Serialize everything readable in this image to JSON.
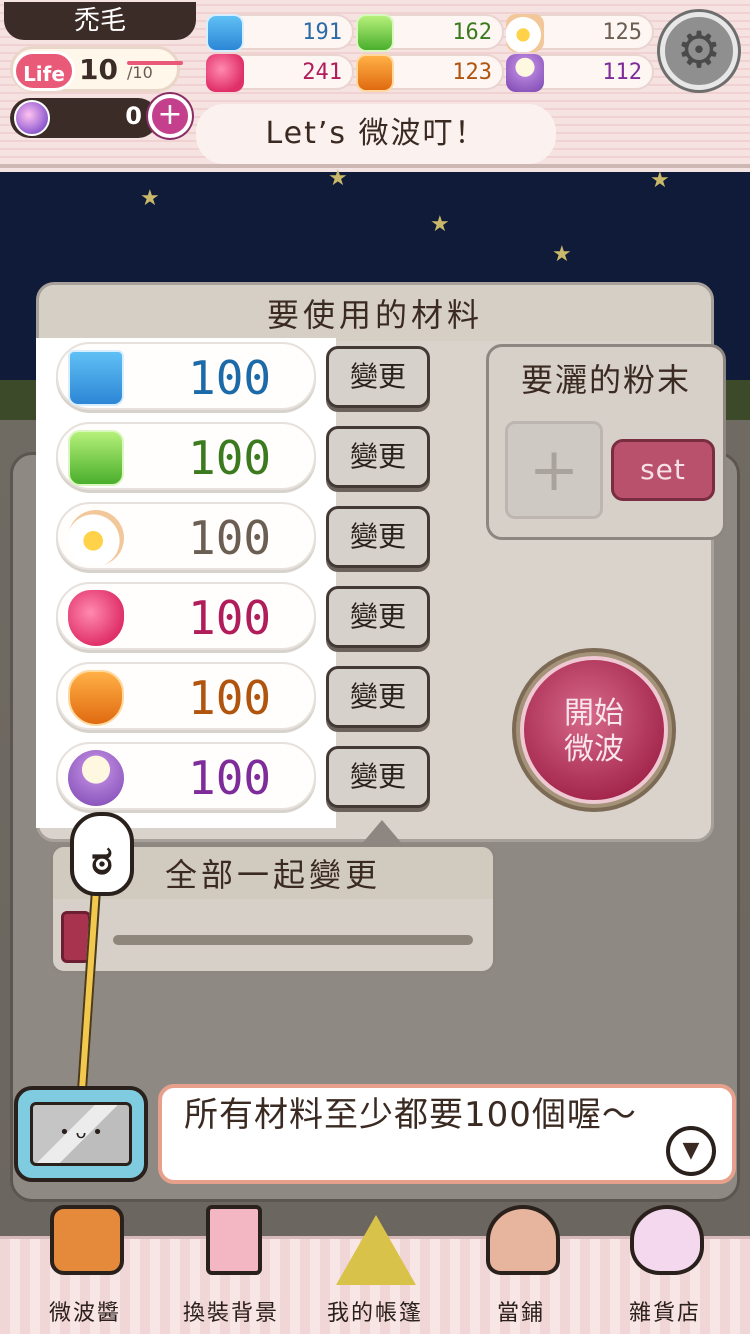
{
  "hud": {
    "player_name": "禿毛",
    "life_label": "Life",
    "life_current": "10",
    "life_max": "/10",
    "gems": "0",
    "gem_add": "+",
    "resources": [
      {
        "name": "milk",
        "value": "191",
        "color": "#2d6aa8"
      },
      {
        "name": "butter",
        "value": "162",
        "color": "#3b7a1e"
      },
      {
        "name": "egg",
        "value": "125",
        "color": "#6b5e52"
      },
      {
        "name": "strawberry",
        "value": "241",
        "color": "#b01d5a"
      },
      {
        "name": "honey",
        "value": "123",
        "color": "#b0540e"
      },
      {
        "name": "flour",
        "value": "112",
        "color": "#7d2c9a"
      }
    ],
    "settings_icon": "⚙",
    "speech": "Let’s 微波叮！"
  },
  "materials": {
    "title": "要使用的材料",
    "change_label": "變更",
    "items": [
      {
        "name": "milk",
        "value": "100",
        "color": "#1d6aa8"
      },
      {
        "name": "butter",
        "value": "100",
        "color": "#3b7a1e"
      },
      {
        "name": "egg",
        "value": "100",
        "color": "#6b5e52"
      },
      {
        "name": "strawberry",
        "value": "100",
        "color": "#b01d5a"
      },
      {
        "name": "honey",
        "value": "100",
        "color": "#b0540e"
      },
      {
        "name": "flour",
        "value": "100",
        "color": "#7d2c9a"
      }
    ]
  },
  "powder": {
    "title": "要灑的粉末",
    "slot_plus": "+",
    "set_label": "set"
  },
  "start": {
    "line1": "開始",
    "line2": "微波"
  },
  "all_change": {
    "title": "全部一起變更"
  },
  "dialog": {
    "text": "所有材料至少都要100個喔～",
    "next_icon": "▼"
  },
  "nav": [
    {
      "label": "微波醬",
      "icon": "tv-icon"
    },
    {
      "label": "換裝背景",
      "icon": "cabinet-icon"
    },
    {
      "label": "我的帳篷",
      "icon": "tent-icon"
    },
    {
      "label": "當鋪",
      "icon": "shop-icon"
    },
    {
      "label": "雜貨店",
      "icon": "ufo-icon"
    }
  ]
}
